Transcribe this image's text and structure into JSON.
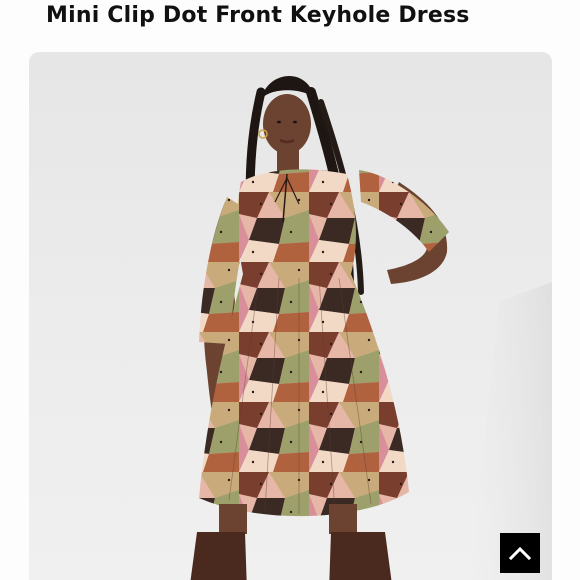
{
  "product": {
    "title": "Mini Clip Dot Front Keyhole Dress"
  },
  "photo": {
    "background_color": "#e9e9e9",
    "dress_palette": [
      "#e6b7a7",
      "#7a3e2e",
      "#c9ab7b",
      "#3b2a24",
      "#9da06a",
      "#d98f9a",
      "#f1d9c6"
    ],
    "boots_color": "#4a2a1f",
    "skin_color": "#6b4330"
  },
  "scroll_top_button": {
    "icon": "chevron-up-icon",
    "background_color": "#000000",
    "icon_color": "#ffffff"
  }
}
